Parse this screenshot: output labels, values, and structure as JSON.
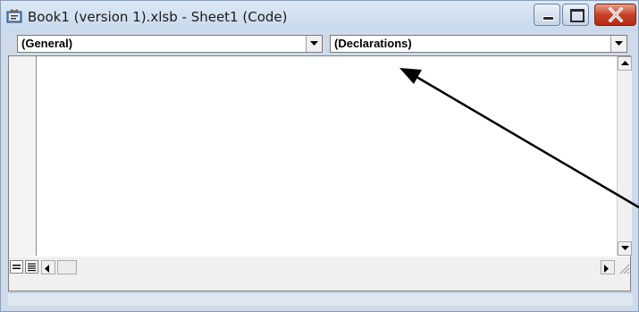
{
  "window": {
    "title": "Book1 (version 1).xlsb - Sheet1 (Code)",
    "icon": "vba-code-module-icon",
    "controls": [
      "minimize-icon",
      "maximize-icon",
      "close-icon"
    ]
  },
  "object_combo": {
    "selected": "(General)",
    "icon": "chevron-down-icon"
  },
  "procedure_combo": {
    "selected": "(Declarations)",
    "icon": "chevron-down-icon"
  },
  "editor": {
    "code_text": ""
  },
  "colors": {
    "title_bar": "#cfdbe9",
    "close_button": "#c7412a",
    "annotation_arrow": "#000000"
  }
}
